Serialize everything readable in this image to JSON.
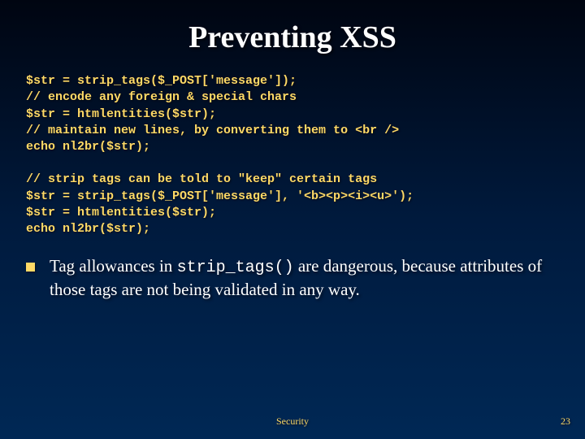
{
  "title": "Preventing XSS",
  "code1": {
    "l1": "$str = strip_tags($_POST['message']);",
    "l2": "// encode any foreign & special chars",
    "l3": "$str = htmlentities($str);",
    "l4": "// maintain new lines, by converting them to <br />",
    "l5": "echo nl2br($str);"
  },
  "code2": {
    "l1": "// strip tags can be told to \"keep\" certain tags",
    "l2": "$str = strip_tags($_POST['message'], '<b><p><i><u>');",
    "l3": "$str = htmlentities($str);",
    "l4": "echo nl2br($str);"
  },
  "bullet": {
    "pre": "Tag allowances in ",
    "mono": "strip_tags()",
    "post": " are dangerous, because attributes of those tags are not being validated in any way."
  },
  "footer": {
    "center": "Security",
    "page": "23"
  }
}
